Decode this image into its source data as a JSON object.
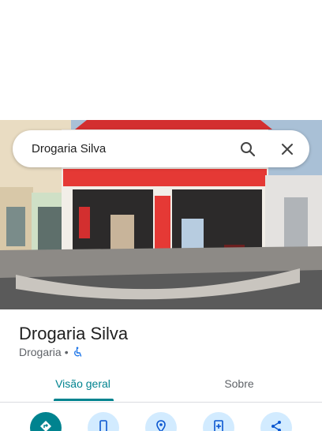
{
  "search": {
    "query": "Drogaria Silva"
  },
  "place": {
    "title": "Drogaria Silva",
    "category": "Drogaria",
    "separator": "•"
  },
  "tabs": [
    {
      "label": "Visão geral",
      "active": true
    },
    {
      "label": "Sobre",
      "active": false
    }
  ],
  "actions": [
    {
      "icon": "directions-icon",
      "primary": true
    },
    {
      "icon": "phone-icon",
      "primary": false
    },
    {
      "icon": "location-pin-icon",
      "primary": false
    },
    {
      "icon": "save-icon",
      "primary": false
    },
    {
      "icon": "share-icon",
      "primary": false
    }
  ],
  "colors": {
    "accent": "#00838f",
    "action_bg": "#d2ebff",
    "store_red": "#d32f2f"
  }
}
